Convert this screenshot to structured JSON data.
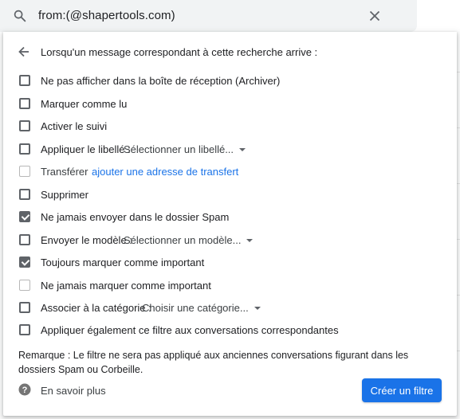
{
  "search": {
    "query": "from:(@shapertools.com)"
  },
  "header": {
    "title": "Lorsqu'un message correspondant à cette recherche arrive :"
  },
  "options": {
    "archive": {
      "label": "Ne pas afficher dans la boîte de réception (Archiver)",
      "checked": false
    },
    "mark_read": {
      "label": "Marquer comme lu",
      "checked": false
    },
    "star": {
      "label": "Activer le suivi",
      "checked": false
    },
    "apply_label": {
      "label": "Appliquer le libellé :",
      "select": "Sélectionner un libellé...",
      "checked": false
    },
    "forward": {
      "label": "Transférer",
      "link": "ajouter une adresse de transfert",
      "checked": false,
      "disabled": true
    },
    "delete": {
      "label": "Supprimer",
      "checked": false
    },
    "never_spam": {
      "label": "Ne jamais envoyer dans le dossier Spam",
      "checked": true
    },
    "send_template": {
      "label": "Envoyer le modèle :",
      "select": "Sélectionner un modèle...",
      "checked": false
    },
    "always_important": {
      "label": "Toujours marquer comme important",
      "checked": true
    },
    "never_important": {
      "label": "Ne jamais marquer comme important",
      "checked": false,
      "disabled": true
    },
    "category": {
      "label": "Associer à la catégorie :",
      "select": "Choisir une catégorie...",
      "checked": false
    },
    "also_apply": {
      "label": "Appliquer également ce filtre aux conversations correspondantes",
      "checked": false
    }
  },
  "note": "Remarque : Le filtre ne sera pas appliqué aux anciennes conversations figurant dans les dossiers Spam ou Corbeille.",
  "footer": {
    "help": "En savoir plus",
    "create_button": "Créer un filtre"
  },
  "colors": {
    "accent": "#1a73e8",
    "checkbox": "#5f6368",
    "searchbar": "#f1f3f4"
  }
}
